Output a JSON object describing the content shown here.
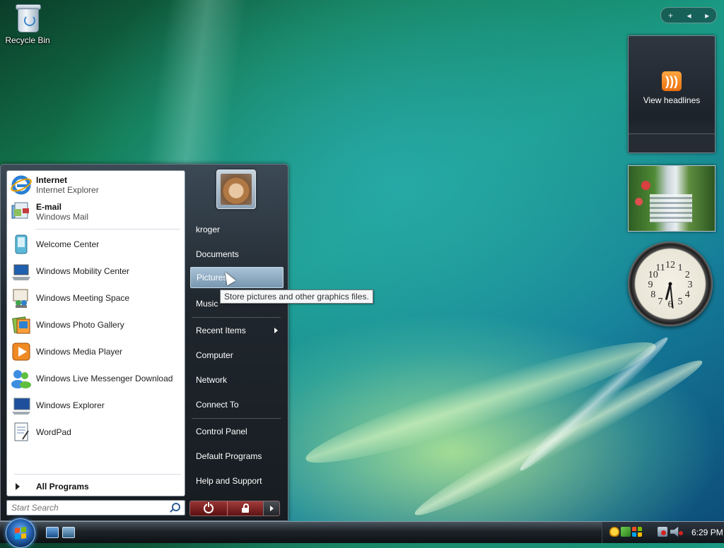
{
  "desktop": {
    "recycle_bin_label": "Recycle Bin"
  },
  "sidebar": {
    "controls": {
      "add": "+",
      "prev": "◂",
      "next": "▸"
    },
    "feed_gadget": {
      "label": "View headlines"
    },
    "clock": {
      "hour": 6,
      "minute": 29
    }
  },
  "start_menu": {
    "pinned": [
      {
        "title": "Internet",
        "subtitle": "Internet Explorer",
        "icon": "internet-explorer-icon"
      },
      {
        "title": "E-mail",
        "subtitle": "Windows Mail",
        "icon": "windows-mail-icon"
      }
    ],
    "recent": [
      {
        "label": "Welcome Center",
        "icon": "welcome-center-icon"
      },
      {
        "label": "Windows Mobility Center",
        "icon": "mobility-center-icon"
      },
      {
        "label": "Windows Meeting Space",
        "icon": "meeting-space-icon"
      },
      {
        "label": "Windows Photo Gallery",
        "icon": "photo-gallery-icon"
      },
      {
        "label": "Windows Media Player",
        "icon": "media-player-icon"
      },
      {
        "label": "Windows Live Messenger Download",
        "icon": "messenger-icon"
      },
      {
        "label": "Windows Explorer",
        "icon": "windows-explorer-icon"
      },
      {
        "label": "WordPad",
        "icon": "wordpad-icon"
      }
    ],
    "all_programs": "All Programs",
    "search_placeholder": "Start Search",
    "right": {
      "username": "kroger",
      "documents": "Documents",
      "pictures": "Pictures",
      "music": "Music",
      "recent_items": "Recent Items",
      "computer": "Computer",
      "network": "Network",
      "connect_to": "Connect To",
      "control_panel": "Control Panel",
      "default_programs": "Default Programs",
      "help_support": "Help and Support"
    },
    "tooltip": "Store pictures and other graphics files."
  },
  "taskbar": {
    "time": "6:29 PM"
  }
}
